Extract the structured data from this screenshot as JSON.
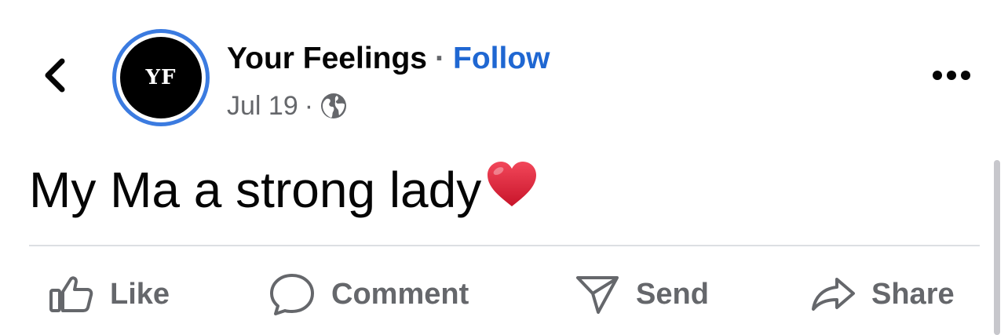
{
  "header": {
    "avatar_initials": "YF",
    "page_name": "Your Feelings",
    "separator": "·",
    "follow_label": "Follow",
    "date": "Jul 19",
    "meta_separator": "·",
    "audience_icon": "globe-icon",
    "back_icon": "chevron-left-icon",
    "more_icon": "more-horizontal-icon"
  },
  "post": {
    "text": "My Ma a strong lady",
    "emoji": "❤️"
  },
  "actions": [
    {
      "label": "Like",
      "icon": "thumbs-up-icon"
    },
    {
      "label": "Comment",
      "icon": "comment-icon"
    },
    {
      "label": "Send",
      "icon": "send-icon"
    },
    {
      "label": "Share",
      "icon": "share-icon"
    }
  ],
  "colors": {
    "accent": "#1f67d2",
    "avatar_ring": "#3b7be0",
    "secondary_text": "#65676b",
    "heart": "#e0263a"
  }
}
